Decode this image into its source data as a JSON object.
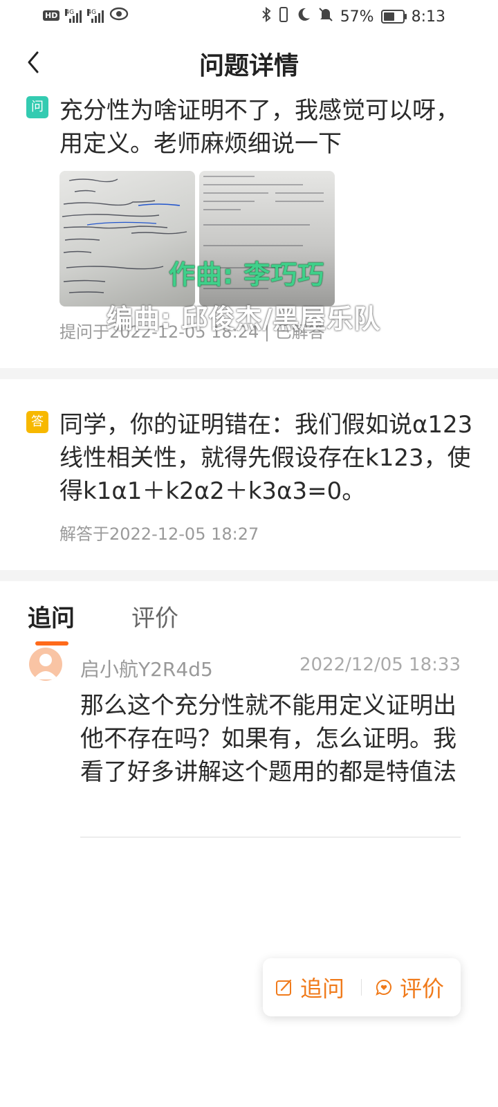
{
  "status_bar": {
    "hd_label": "HD",
    "network_1": "4G",
    "network_2": "4G",
    "battery_percent_text": "57%",
    "battery_level": 0.57,
    "time": "8:13",
    "icons": [
      "hd-icon",
      "signal-icon",
      "signal-icon",
      "eye-icon",
      "bluetooth-icon",
      "vibrate-icon",
      "moon-icon",
      "mute-icon",
      "battery-icon"
    ]
  },
  "header": {
    "title": "问题详情",
    "back_icon": "chevron-left-icon"
  },
  "question": {
    "badge": "问",
    "text": "充分性为啥证明不了，我感觉可以呀，用定义。老师麻烦细说一下",
    "meta": "提问于2022-12-05 18:24 | 已解答",
    "badge_color": "#33cbb1"
  },
  "overlay": {
    "line1": "作曲: 李巧巧",
    "line2": "编曲: 邱俊杰/黑屋乐队"
  },
  "answer": {
    "badge": "答",
    "text": "同学，你的证明错在：我们假如说α123线性相关性，就得先假设存在k123，使得k1α1＋k2α2＋k3α3=0。",
    "meta": "解答于2022-12-05 18:27",
    "badge_color": "#f7b800"
  },
  "tabs": [
    {
      "label": "追问",
      "active": true
    },
    {
      "label": "评价",
      "active": false
    }
  ],
  "follow_up": {
    "user": "启小航Y2R4d5",
    "time": "2022/12/05 18:33",
    "text": "那么这个充分性就不能用定义证明出他不存在吗？如果有，怎么证明。我看了好多讲解这个题用的都是特值法"
  },
  "actions": {
    "follow_up_label": "追问",
    "rate_label": "评价",
    "accent_color": "#f07a1a"
  }
}
